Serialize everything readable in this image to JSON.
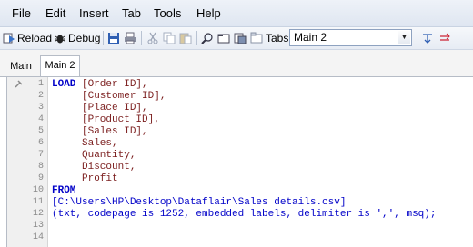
{
  "menu": [
    "File",
    "Edit",
    "Insert",
    "Tab",
    "Tools",
    "Help"
  ],
  "toolbar": {
    "reload_label": "Reload",
    "debug_label": "Debug",
    "tabs_label": "Tabs",
    "tab_select_value": "Main 2"
  },
  "tabs": [
    {
      "label": "Main",
      "active": false
    },
    {
      "label": "Main 2",
      "active": true
    }
  ],
  "editor": {
    "line_numbers": [
      "1",
      "2",
      "3",
      "4",
      "5",
      "6",
      "7",
      "8",
      "9",
      "10",
      "11",
      "12",
      "13",
      "14"
    ],
    "lines": [
      {
        "kw": "LOAD",
        "text": " [Order ID],"
      },
      {
        "text": "     [Customer ID],"
      },
      {
        "text": "     [Place ID],"
      },
      {
        "text": "     [Product ID],"
      },
      {
        "text": "     [Sales ID],"
      },
      {
        "text": "     Sales,"
      },
      {
        "text": "     Quantity,"
      },
      {
        "text": "     Discount,"
      },
      {
        "text": "     Profit"
      },
      {
        "kw": "FROM"
      },
      {
        "text": "[C:\\Users\\HP\\Desktop\\Dataflair\\Sales details.csv]"
      },
      {
        "text": "(txt, codepage is 1252, embedded labels, delimiter is ',', msq);"
      },
      {
        "text": ""
      },
      {
        "text": ""
      }
    ]
  },
  "colors": {
    "keyword": "#0000c8",
    "field": "#7b1e1e",
    "menubar_bg": "#dfe6f1"
  }
}
